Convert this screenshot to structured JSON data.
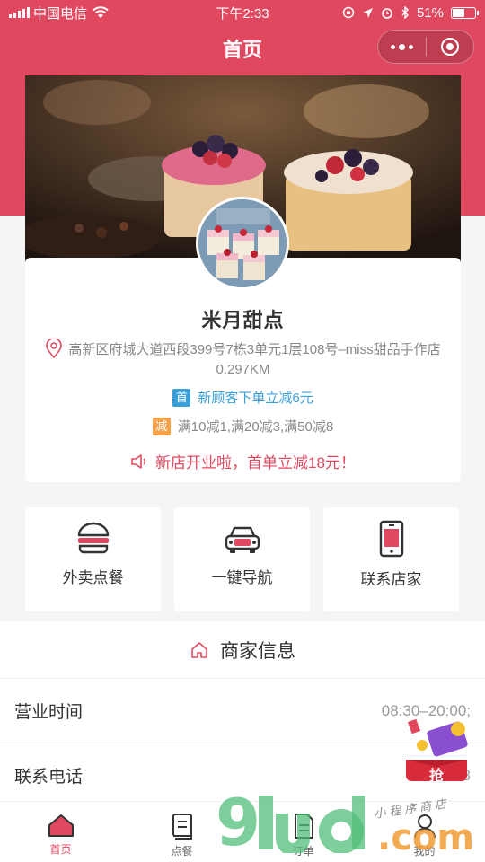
{
  "status_bar": {
    "carrier": "中国电信",
    "time": "下午2:33",
    "battery": "51%",
    "battery_level": 0.51
  },
  "navbar": {
    "title": "首页"
  },
  "shop": {
    "name": "米月甜点",
    "address": "高新区府城大道西段399号7栋3单元1层108号–miss甜品手作店",
    "distance": "0.297KM",
    "promo_new_tag": "首",
    "promo_new": "新顾客下单立减6元",
    "promo_discount_tag": "减",
    "promo_discount": "满10减1,满20减3,满50减8",
    "notice": "新店开业啦，首单立减18元！"
  },
  "quick_actions": [
    {
      "label": "外卖点餐",
      "icon": "burger-icon"
    },
    {
      "label": "一键导航",
      "icon": "car-icon"
    },
    {
      "label": "联系店家",
      "icon": "phone-icon"
    }
  ],
  "merchant_info": {
    "title": "商家信息",
    "rows": [
      {
        "label": "营业时间",
        "value": "08:30–20:00;"
      },
      {
        "label": "联系电话",
        "value": "1838"
      }
    ]
  },
  "grab_badge": "抢",
  "tabs": [
    {
      "label": "首页",
      "icon": "home-icon",
      "active": true
    },
    {
      "label": "点餐",
      "icon": "menu-book-icon",
      "active": false
    },
    {
      "label": "订单",
      "icon": "order-icon",
      "active": false
    },
    {
      "label": "我的",
      "icon": "user-icon",
      "active": false
    }
  ],
  "watermark": {
    "digits": "9",
    "brand": ".com",
    "tagline": "小程序商店"
  },
  "colors": {
    "brand": "#e0485f",
    "promo_blue": "#3a9fd8",
    "promo_orange": "#f5a04a"
  }
}
